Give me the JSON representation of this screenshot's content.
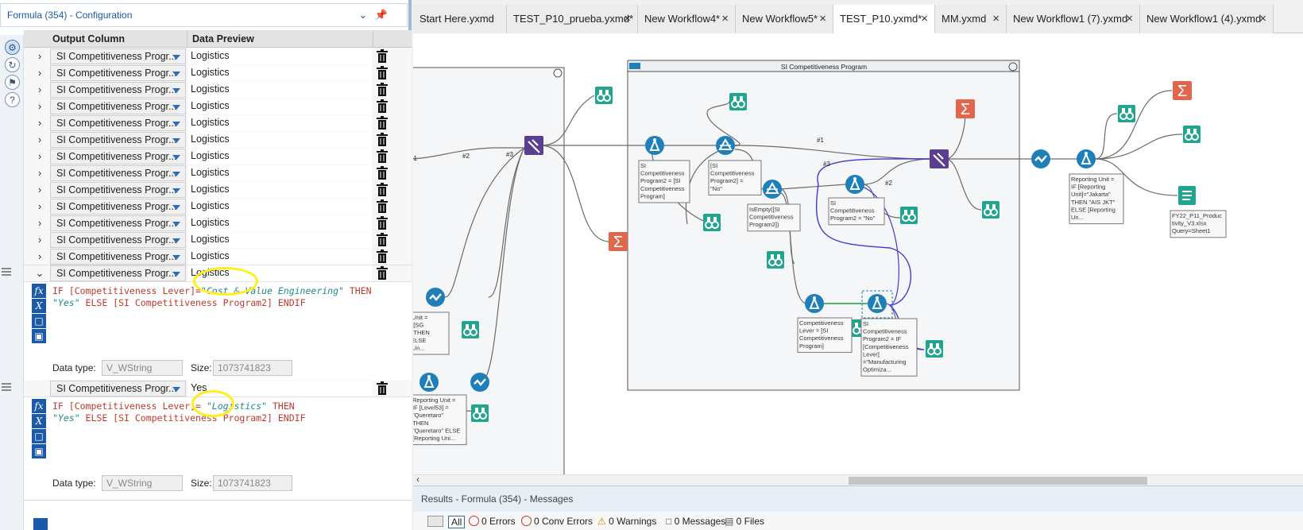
{
  "config": {
    "title": "Formula (354) - Configuration",
    "col_output": "Output Column",
    "col_preview": "Data Preview",
    "row_field": "SI Competitiveness Progr...",
    "rows": [
      "Logistics",
      "Logistics",
      "Logistics",
      "Logistics",
      "Logistics",
      "Logistics",
      "Logistics",
      "Logistics",
      "Logistics",
      "Logistics",
      "Logistics",
      "Logistics",
      "Logistics"
    ],
    "expanded1": {
      "field": "SI Competitiveness Progr...",
      "preview": "Logistics",
      "line1_a": "IF [Competitiveness Lever]=",
      "line1_b": "\"Cost & Value Engineering\"",
      "line1_c": " THEN",
      "line2_a": "\"Yes\"",
      "line2_b": " ELSE [SI Competitiveness Program2] ENDIF",
      "datatype_label": "Data type:",
      "datatype": "V_WString",
      "size_label": "Size:",
      "size": "1073741823"
    },
    "expanded2": {
      "field": "SI Competitiveness Progr...",
      "preview": "Yes",
      "line1_a": "IF [Competitiveness Lever]= ",
      "line1_b": "\"Logistics\"",
      "line1_c": " THEN",
      "line2_a": "\"Yes\"",
      "line2_b": " ELSE [SI Competitiveness Program2] ENDIF",
      "datatype_label": "Data type:",
      "datatype": "V_WString",
      "size_label": "Size:",
      "size": "1073741823"
    }
  },
  "tabs": [
    {
      "label": "Start Here.yxmd",
      "active": false
    },
    {
      "label": "TEST_P10_prueba.yxmd*",
      "active": false
    },
    {
      "label": "New Workflow4*",
      "active": false
    },
    {
      "label": "New Workflow5*",
      "active": false
    },
    {
      "label": "TEST_P10.yxmd*",
      "active": true
    },
    {
      "label": "MM.yxmd",
      "active": false
    },
    {
      "label": "New Workflow1 (7).yxmd",
      "active": false
    },
    {
      "label": "New Workflow1 (4).yxmd",
      "active": false
    }
  ],
  "canvas": {
    "container_title": "SI Competitiveness Program",
    "labels": {
      "n1a": "#1",
      "n2": "#2",
      "n3": "#3",
      "n1b": "#1",
      "n3b": "#3",
      "n2b": "#2",
      "ann_formula1": [
        "SI",
        "Competitiveness",
        "Program2 = [SI",
        "Competitiveness",
        "Program]"
      ],
      "ann_filter1": [
        "[SI",
        "Competitiveness",
        "Program2] =",
        "\"No\""
      ],
      "ann_filter2": [
        "IsEmpty([SI",
        "Competitiveness",
        "Program2])"
      ],
      "ann_formula2": [
        "SI",
        "Competitiveness",
        "Program2 = \"No\""
      ],
      "ann_formula3": [
        "Competitiveness",
        "Lever = [SI",
        "Competitiveness",
        "Program]"
      ],
      "ann_formula4": [
        "SI",
        "Competitiveness",
        "Program2 = IF",
        "[Competitiveness",
        "Lever]",
        "=\"Manufacturing",
        "Optimiza..."
      ],
      "ann_formula5": [
        "Reporting Unit =",
        "IF [Reporting",
        "Unit]=\"Jakarta\"",
        "THEN \"AIS JKT\"",
        "ELSE [Reporting",
        "Un..."
      ],
      "ann_output": [
        "FY22_P11_Produc",
        "tivity_V3.xlsx",
        "Query=Sheet1"
      ],
      "ann_left1": [
        "rting Unit =",
        "dS]=\"[SG",
        "DG)\" THEN",
        "Ind\" ELSE",
        "rting Un..."
      ],
      "ann_left2": [
        "Reporting Unit =",
        "IF [Level53] =",
        "\"Queretaro\"",
        "THEN",
        "\"Queretaro\" ELSE",
        "[Reporting Uni..."
      ]
    }
  },
  "results": {
    "title": "Results - Formula (354) - Messages",
    "all": "All",
    "errors": "0 Errors",
    "conv_errors": "0 Conv Errors",
    "warnings": "0 Warnings",
    "messages": "0 Messages",
    "files": "0 Files"
  },
  "colors": {
    "accent": "#1a5aa8",
    "formula": "#1f7fb8",
    "browse": "#21a58f",
    "summarize": "#e0674e",
    "join": "#5b3e8f",
    "highlight": "#ffef1a"
  }
}
